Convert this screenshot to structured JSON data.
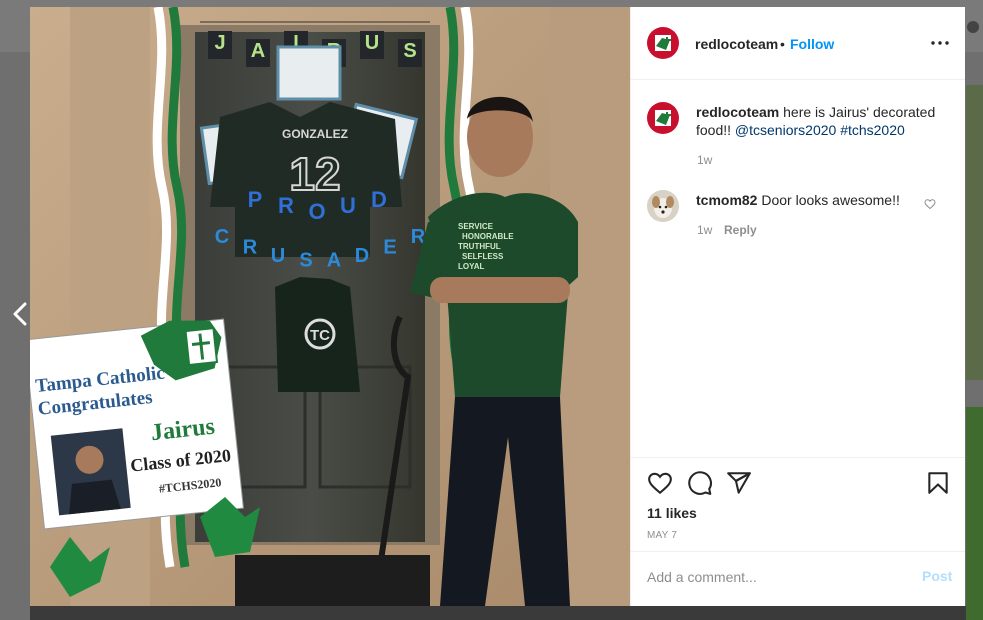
{
  "post": {
    "username": "redlocoteam",
    "follow_label": "Follow",
    "separator": "•"
  },
  "caption": {
    "username": "redlocoteam",
    "text": "here is Jairus' decorated food!!",
    "tags": "@tcseniors2020 #tchs2020",
    "time": "1w"
  },
  "comments": [
    {
      "username": "tcmom82",
      "text": "Door looks awesome!!",
      "time": "1w",
      "reply_label": "Reply"
    }
  ],
  "stats": {
    "likes": "11 likes",
    "date": "MAY 7"
  },
  "composer": {
    "placeholder": "Add a comment...",
    "post_label": "Post"
  },
  "photo": {
    "banner_letters": [
      "J",
      "A",
      "I",
      "R",
      "U",
      "S"
    ],
    "jersey_name": "GONZALEZ",
    "jersey_number": "12",
    "proud_letters": [
      "P",
      "R",
      "O",
      "U",
      "D"
    ],
    "crusader_letters": [
      "C",
      "R",
      "U",
      "S",
      "A",
      "D",
      "E",
      "R"
    ],
    "sign": {
      "line1": "Tampa Catholic",
      "line2": "Congratulates",
      "name": "Jairus",
      "class": "Class of 2020",
      "hashtag": "#TCHS2020"
    },
    "shirt_text": [
      "SERVICE",
      "HONORABLE",
      "TRUTHFUL",
      "SELFLESS",
      "LOYAL"
    ]
  },
  "colors": {
    "accent": "#0095f6",
    "brand_red": "#c8102e",
    "text": "#262626",
    "muted": "#8e8e8e",
    "crusader_green": "#1f7a3c"
  },
  "icons": {
    "prev": "chevron-left-icon",
    "more": "more-horizontal-icon",
    "like": "heart-icon",
    "comment": "comment-bubble-icon",
    "share": "paper-plane-icon",
    "save": "bookmark-icon"
  }
}
